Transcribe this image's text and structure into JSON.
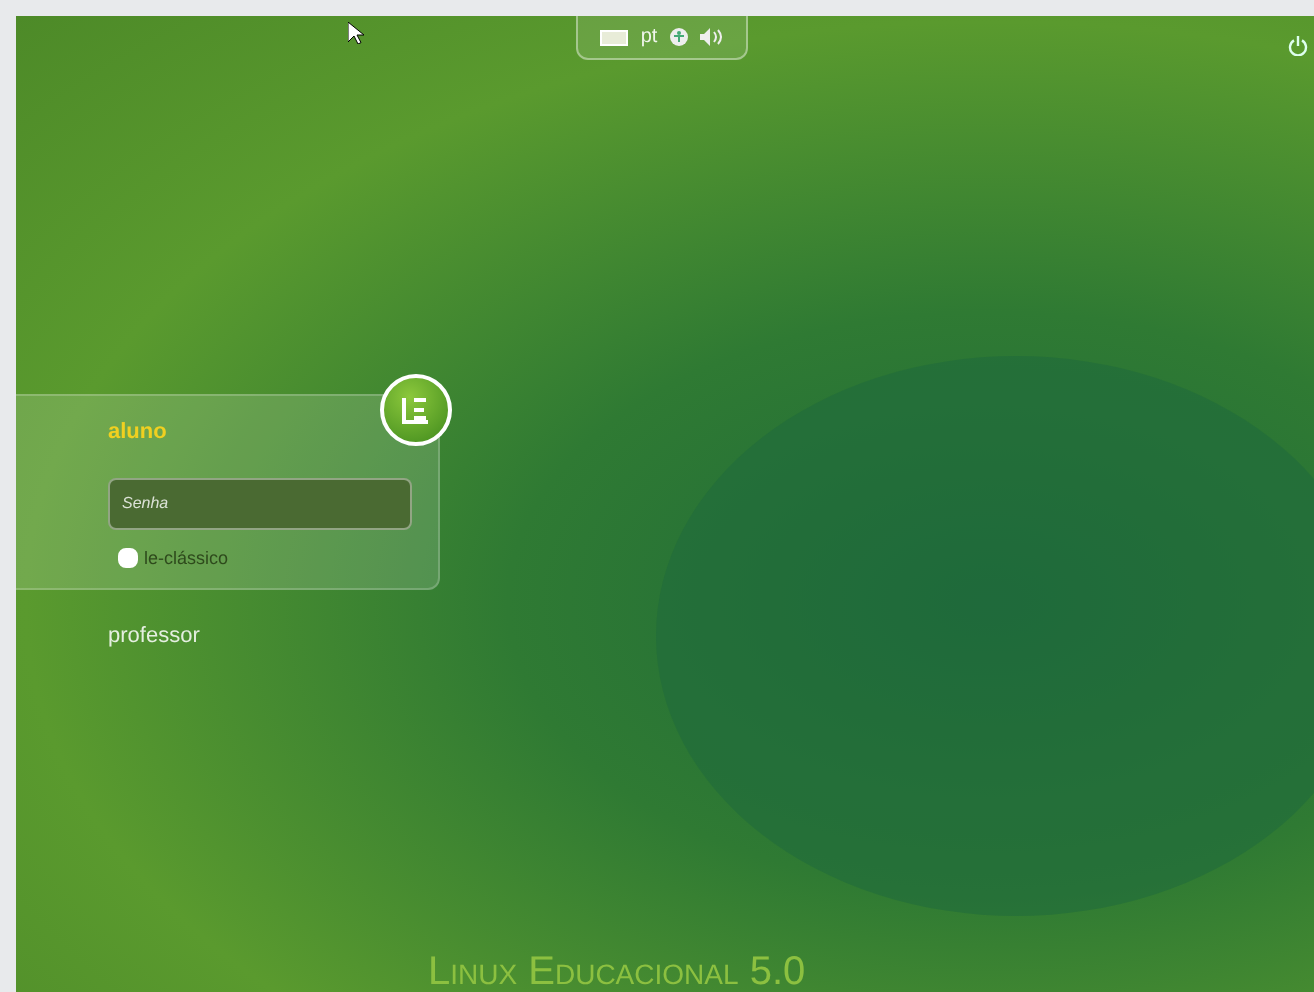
{
  "top_panel": {
    "keyboard_layout": "pt"
  },
  "login": {
    "selected_user": "aluno",
    "password": {
      "placeholder": "Senha"
    },
    "session": {
      "label": "le-clássico",
      "checked": false
    }
  },
  "other_users": [
    "professor"
  ],
  "footer": {
    "text": "Linux Educacional 5.0"
  }
}
